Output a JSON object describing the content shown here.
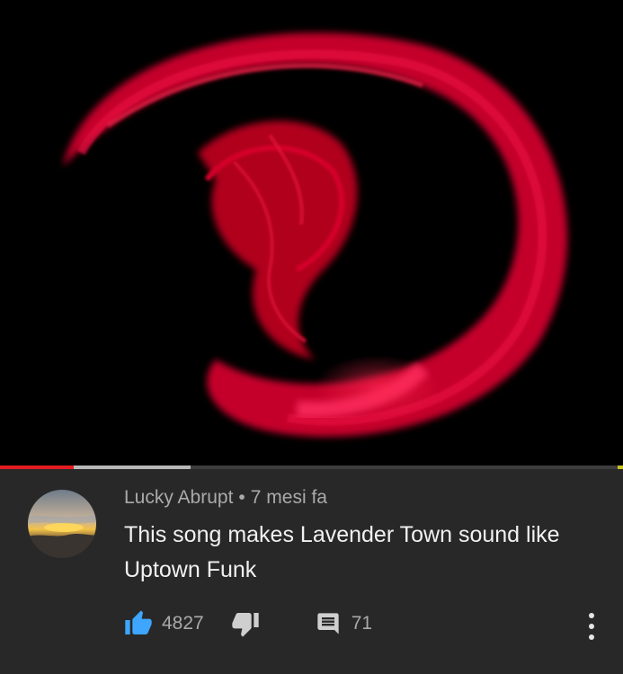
{
  "player": {
    "progress_played": 0.118,
    "progress_buffered": 0.306
  },
  "comment": {
    "author": "Lucky Abrupt",
    "separator": "•",
    "time": "7 mesi fa",
    "text": "This song makes Lavender Town sound like Uptown Funk",
    "like_count": "4827",
    "reply_count": "71"
  },
  "icons": {
    "like": "thumbs-up-icon",
    "dislike": "thumbs-down-icon",
    "reply": "comment-icon",
    "more": "more-vertical-icon"
  },
  "colors": {
    "background": "#282828",
    "like_active": "#3ea6ff",
    "progress_played": "#e21c21",
    "text_secondary": "#aaaaaa",
    "text_primary": "#f1f1f1"
  }
}
